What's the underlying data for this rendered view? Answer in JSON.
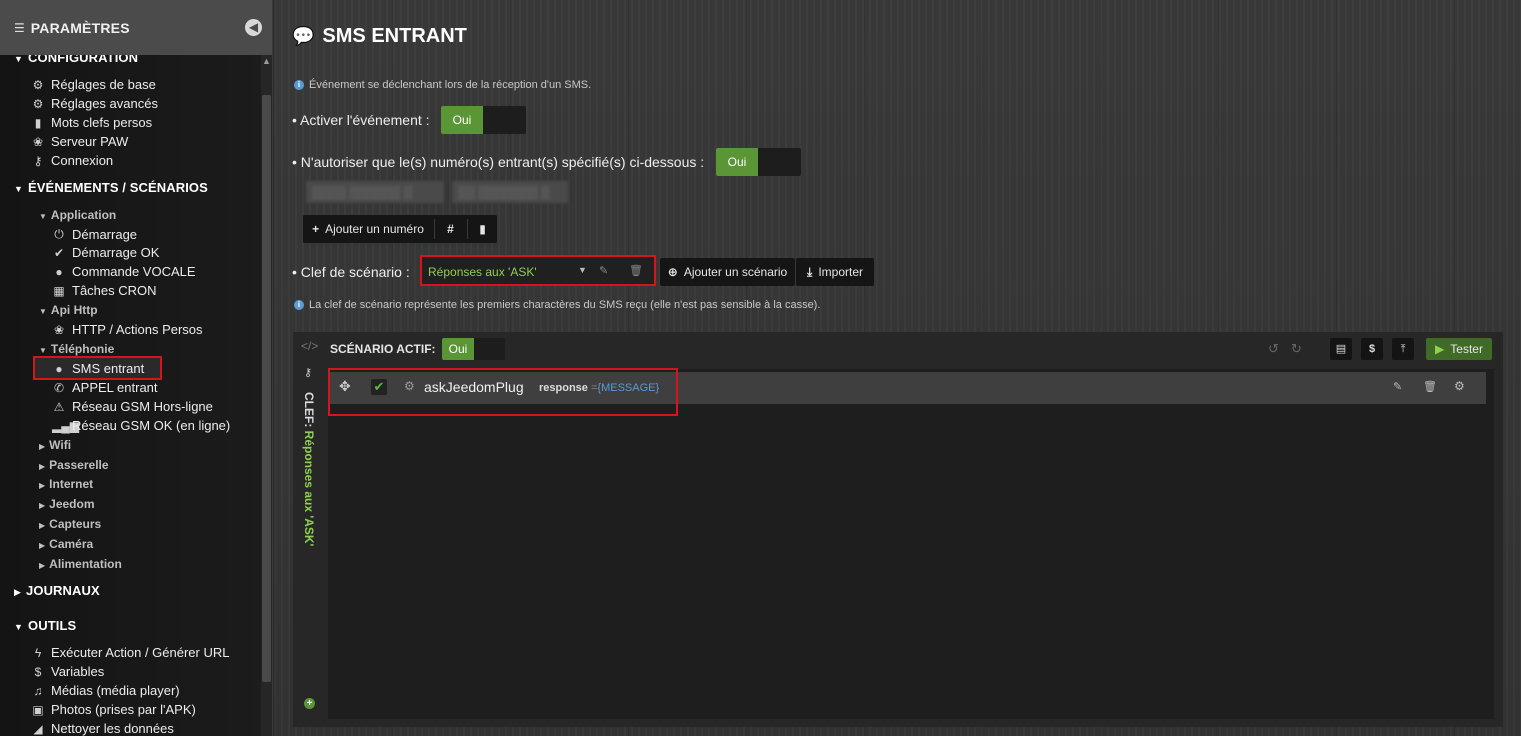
{
  "sidebar": {
    "title": "PARAMÈTRES",
    "configuration": {
      "label": "CONFIGURATION",
      "items": [
        {
          "label": "Réglages de base",
          "icon": "gear-icon"
        },
        {
          "label": "Réglages avancés",
          "icon": "gears-icon"
        },
        {
          "label": "Mots clefs persos",
          "icon": "book-icon"
        },
        {
          "label": "Serveur PAW",
          "icon": "paw-icon"
        },
        {
          "label": "Connexion",
          "icon": "key-icon"
        }
      ]
    },
    "events": {
      "label": "ÉVÉNEMENTS / SCÉNARIOS",
      "application": {
        "label": "Application",
        "items": [
          {
            "label": "Démarrage",
            "icon": "power-icon"
          },
          {
            "label": "Démarrage OK",
            "icon": "check-icon"
          },
          {
            "label": "Commande VOCALE",
            "icon": "microphone-icon"
          },
          {
            "label": "Tâches CRON",
            "icon": "calendar-icon"
          }
        ]
      },
      "api_http": {
        "label": "Api Http",
        "items": [
          {
            "label": "HTTP / Actions Persos",
            "icon": "paw-icon"
          }
        ]
      },
      "telephonie": {
        "label": "Téléphonie",
        "items": [
          {
            "label": "SMS entrant",
            "icon": "comment-icon"
          },
          {
            "label": "APPEL entrant",
            "icon": "phone-icon"
          },
          {
            "label": "Réseau GSM Hors-ligne",
            "icon": "warning-icon"
          },
          {
            "label": "Réseau GSM OK (en ligne)",
            "icon": "signal-icon"
          }
        ]
      },
      "collapsed_groups": [
        "Wifi",
        "Passerelle",
        "Internet",
        "Jeedom",
        "Capteurs",
        "Caméra",
        "Alimentation"
      ]
    },
    "journaux": {
      "label": "JOURNAUX"
    },
    "outils": {
      "label": "OUTILS",
      "items": [
        {
          "label": "Exécuter Action / Générer URL",
          "icon": "bolt-icon"
        },
        {
          "label": "Variables",
          "icon": "dollar-icon"
        },
        {
          "label": "Médias (média player)",
          "icon": "music-icon"
        },
        {
          "label": "Photos (prises par l'APK)",
          "icon": "picture-icon"
        },
        {
          "label": "Nettoyer les données",
          "icon": "eraser-icon"
        }
      ]
    }
  },
  "main": {
    "title": "SMS ENTRANT",
    "info_event": "Événement se déclenchant lors de la réception d'un SMS.",
    "activate_label": "• Activer l'événement :",
    "activate_toggle": "Oui",
    "numbers_label": "• N'autoriser que le(s) numéro(s) entrant(s) spécifié(s) ci-dessous :",
    "numbers_toggle": "Oui",
    "add_number_button": "Ajouter un numéro",
    "clef_label": "• Clef de scénario :",
    "clef_value": "Réponses aux 'ASK'",
    "add_scenario_button": "Ajouter un scénario",
    "import_button": "Importer",
    "info_clef": "La clef de scénario représente les premiers charactères du SMS reçu (elle n'est pas sensible à la casse).",
    "scenario": {
      "active_label": "SCÉNARIO ACTIF:",
      "active_toggle": "Oui",
      "test_button": "Tester",
      "vertical_prefix": "CLEF:",
      "vertical_value": "Réponses aux 'ASK'",
      "action": {
        "name": "askJeedomPlug",
        "param_name": "response",
        "param_eq": "=",
        "param_value": "{MESSAGE}"
      }
    }
  },
  "colors": {
    "accent_green": "#5a9636",
    "text_green": "#8fd14f",
    "highlight_red": "#d3161e"
  }
}
